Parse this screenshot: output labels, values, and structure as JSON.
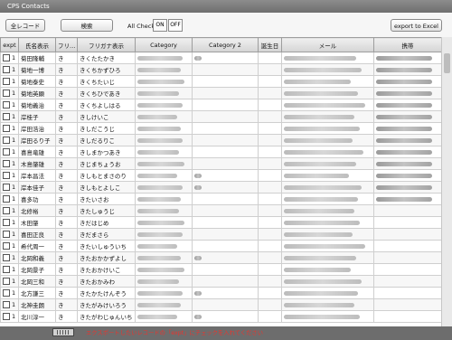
{
  "window": {
    "title": "CPS Contacts"
  },
  "toolbar": {
    "all_records_label": "全レコード",
    "search_label": "検索",
    "all_check_label": "All Check",
    "on_label": "ON",
    "off_label": "OFF",
    "export_label": "export to Excel"
  },
  "table": {
    "columns": [
      "expt",
      "氏名表示",
      "フリ…",
      "フリガナ表示",
      "Category",
      "Category 2",
      "誕生日",
      "メール",
      "携帯"
    ],
    "rows": [
      {
        "expt": "1",
        "name": "菊田隆輔",
        "furi": "き",
        "kana": "きくたたかき"
      },
      {
        "expt": "1",
        "name": "菊地一博",
        "furi": "き",
        "kana": "きくちかずひろ"
      },
      {
        "expt": "1",
        "name": "菊地泰史",
        "furi": "き",
        "kana": "きくちたいじ"
      },
      {
        "expt": "1",
        "name": "菊地英顕",
        "furi": "き",
        "kana": "きくちひであき"
      },
      {
        "expt": "1",
        "name": "菊地義治",
        "furi": "き",
        "kana": "きくちよしはる"
      },
      {
        "expt": "1",
        "name": "岸桂子",
        "furi": "き",
        "kana": "きしけいこ"
      },
      {
        "expt": "1",
        "name": "岸田浩治",
        "furi": "き",
        "kana": "きしだこうじ"
      },
      {
        "expt": "1",
        "name": "岸田るり子",
        "furi": "き",
        "kana": "きしだるりこ"
      },
      {
        "expt": "1",
        "name": "喜島竜雄",
        "furi": "き",
        "kana": "きしまかつあき"
      },
      {
        "expt": "1",
        "name": "木島肇雄",
        "furi": "き",
        "kana": "きじまちょうお"
      },
      {
        "expt": "1",
        "name": "岸本昌法",
        "furi": "き",
        "kana": "きしもとまさのり"
      },
      {
        "expt": "1",
        "name": "岸本佳子",
        "furi": "き",
        "kana": "きしもとよしこ"
      },
      {
        "expt": "1",
        "name": "喜多功",
        "furi": "き",
        "kana": "きたいさお"
      },
      {
        "expt": "1",
        "name": "北修裕",
        "furi": "き",
        "kana": "きたしゅうじ"
      },
      {
        "expt": "1",
        "name": "木田肇",
        "furi": "き",
        "kana": "きだはじめ"
      },
      {
        "expt": "1",
        "name": "喜田正良",
        "furi": "き",
        "kana": "きだまさら"
      },
      {
        "expt": "1",
        "name": "希代周一",
        "furi": "き",
        "kana": "きたいしゅういち"
      },
      {
        "expt": "1",
        "name": "北岡和義",
        "furi": "き",
        "kana": "きたおかかずよし"
      },
      {
        "expt": "1",
        "name": "北岡景子",
        "furi": "き",
        "kana": "きたおかけいこ"
      },
      {
        "expt": "1",
        "name": "北岡三和",
        "furi": "き",
        "kana": "きたおかみわ"
      },
      {
        "expt": "1",
        "name": "北方謙三",
        "furi": "き",
        "kana": "きたかたけんぞう"
      },
      {
        "expt": "1",
        "name": "北神圭朗",
        "furi": "き",
        "kana": "きたがみけいろう"
      },
      {
        "expt": "1",
        "name": "北川淳一",
        "furi": "き",
        "kana": "きたがわじゅんいち"
      }
    ]
  },
  "status": {
    "message": "エクスポートしたいレコードの「expt」にチェックを入れてください"
  },
  "colors": {
    "status_text": "#e8352f",
    "statusbar_bg": "#6d6d6d",
    "titlebar_bg": "#7d7d7d"
  }
}
